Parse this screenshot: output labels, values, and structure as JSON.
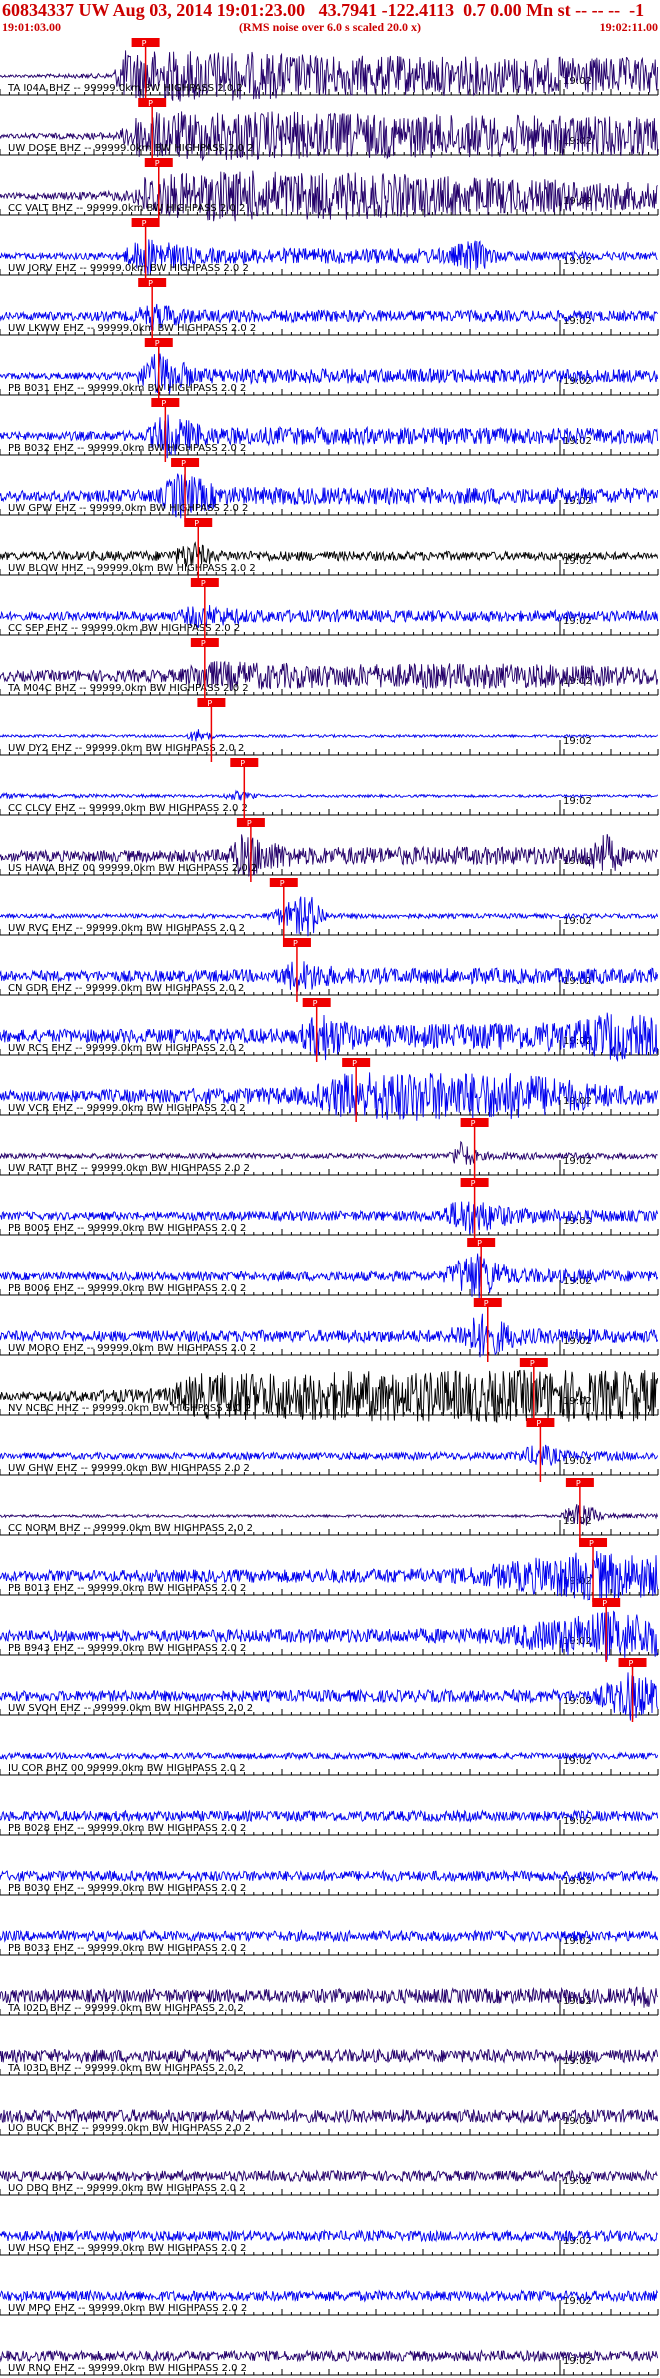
{
  "header": {
    "title": "60834337 UW Aug 03, 2014 19:01:23.00   43.7941 -122.4113  0.7 0.00 Mn st -- -- --  -1",
    "start_time": "19:01:03.00",
    "scale_note": "(RMS noise over 6.0 s scaled 20.0 x)",
    "end_time": "19:02:11.00"
  },
  "colors": {
    "text": "#000000",
    "header_red": "#cc0000",
    "pick": "#ee0000",
    "grid": "#000000"
  },
  "minute_label": "19:02",
  "pick_label": "P",
  "traces": [
    {
      "label": "TA I04A BHZ -- 99999.0km BW HIGHPASS  2.0  2",
      "color": "#24006a",
      "pick": 0.2,
      "env": [
        [
          0,
          0.05
        ],
        [
          0.17,
          0.1
        ],
        [
          0.19,
          1.0
        ],
        [
          0.32,
          1.0
        ],
        [
          0.5,
          0.8
        ],
        [
          1,
          0.7
        ]
      ]
    },
    {
      "label": "UW DOSE BHZ -- 99999.0km BW HIGHPASS  2.0  2",
      "color": "#24006a",
      "pick": 0.21,
      "env": [
        [
          0,
          0.08
        ],
        [
          0.18,
          0.15
        ],
        [
          0.21,
          0.9
        ],
        [
          0.34,
          1.0
        ],
        [
          0.6,
          0.85
        ],
        [
          1,
          0.75
        ]
      ]
    },
    {
      "label": "CC VALT BHZ -- 99999.0km BW HIGHPASS  2.0  2",
      "color": "#24006a",
      "pick": 0.22,
      "env": [
        [
          0,
          0.1
        ],
        [
          0.2,
          0.2
        ],
        [
          0.22,
          0.8
        ],
        [
          0.34,
          1.0
        ],
        [
          0.55,
          0.9
        ],
        [
          1,
          0.5
        ]
      ]
    },
    {
      "label": "UW JORV EHZ -- 99999.0km BW HIGHPASS  2.0  2",
      "color": "#0000ee",
      "pick": 0.2,
      "env": [
        [
          0,
          0.12
        ],
        [
          0.18,
          0.15
        ],
        [
          0.22,
          0.75
        ],
        [
          0.3,
          0.3
        ],
        [
          0.68,
          0.3
        ],
        [
          0.72,
          0.7
        ],
        [
          0.76,
          0.2
        ],
        [
          1,
          0.15
        ]
      ]
    },
    {
      "label": "UW LKWW EHZ -- 99999.0km BW HIGHPASS  2.0  2",
      "color": "#0000ee",
      "pick": 0.21,
      "env": [
        [
          0,
          0.15
        ],
        [
          0.2,
          0.2
        ],
        [
          0.23,
          0.55
        ],
        [
          0.3,
          0.25
        ],
        [
          1,
          0.2
        ]
      ]
    },
    {
      "label": "PB B031 EHZ -- 99999.0km BW HIGHPASS  2.0  2",
      "color": "#0000ee",
      "pick": 0.22,
      "env": [
        [
          0,
          0.12
        ],
        [
          0.2,
          0.15
        ],
        [
          0.24,
          0.95
        ],
        [
          0.3,
          0.3
        ],
        [
          1,
          0.25
        ]
      ]
    },
    {
      "label": "PB B032 EHZ -- 99999.0km BW HIGHPASS  2.0  2",
      "color": "#0000ee",
      "pick": 0.23,
      "env": [
        [
          0,
          0.15
        ],
        [
          0.22,
          0.2
        ],
        [
          0.25,
          0.9
        ],
        [
          0.32,
          0.35
        ],
        [
          1,
          0.3
        ]
      ]
    },
    {
      "label": "UW GPW EHZ -- 99999.0km BW HIGHPASS  2.0  2",
      "color": "#0000ee",
      "pick": 0.26,
      "env": [
        [
          0,
          0.2
        ],
        [
          0.24,
          0.25
        ],
        [
          0.27,
          1.0
        ],
        [
          0.34,
          0.35
        ],
        [
          1,
          0.3
        ]
      ]
    },
    {
      "label": "UW BLOW HHZ -- 99999.0km BW HIGHPASS  2.0  2",
      "color": "#000000",
      "pick": 0.28,
      "env": [
        [
          0,
          0.15
        ],
        [
          0.26,
          0.2
        ],
        [
          0.29,
          0.6
        ],
        [
          0.33,
          0.2
        ],
        [
          1,
          0.15
        ]
      ]
    },
    {
      "label": "CC SEP EHZ -- 99999.0km BW HIGHPASS  2.0  2",
      "color": "#0000ee",
      "pick": 0.29,
      "env": [
        [
          0,
          0.15
        ],
        [
          0.27,
          0.2
        ],
        [
          0.3,
          0.5
        ],
        [
          0.38,
          0.25
        ],
        [
          1,
          0.2
        ]
      ]
    },
    {
      "label": "TA M04C BHZ -- 99999.0km BW HIGHPASS  2.0  2",
      "color": "#24006a",
      "pick": 0.29,
      "env": [
        [
          0,
          0.2
        ],
        [
          0.27,
          0.25
        ],
        [
          0.31,
          0.6
        ],
        [
          0.5,
          0.45
        ],
        [
          0.75,
          0.5
        ],
        [
          1,
          0.35
        ]
      ]
    },
    {
      "label": "UW DY2 EHZ -- 99999.0km BW HIGHPASS  2.0  2",
      "color": "#0000ee",
      "pick": 0.3,
      "env": [
        [
          0,
          0.05
        ],
        [
          0.28,
          0.05
        ],
        [
          0.3,
          0.3
        ],
        [
          0.33,
          0.05
        ],
        [
          1,
          0.05
        ]
      ]
    },
    {
      "label": "CC CLCV EHZ -- 99999.0km BW HIGHPASS  2.0  2",
      "color": "#0000ee",
      "pick": 0.35,
      "env": [
        [
          0,
          0.12
        ],
        [
          0.06,
          0.08
        ],
        [
          0.33,
          0.05
        ],
        [
          0.36,
          0.2
        ],
        [
          0.4,
          0.05
        ],
        [
          1,
          0.05
        ]
      ]
    },
    {
      "label": "US HAWA BHZ 00 99999.0km BW HIGHPASS  2.0  2",
      "color": "#24006a",
      "pick": 0.36,
      "env": [
        [
          0,
          0.2
        ],
        [
          0.34,
          0.25
        ],
        [
          0.37,
          0.9
        ],
        [
          0.45,
          0.35
        ],
        [
          0.88,
          0.35
        ],
        [
          0.92,
          0.9
        ],
        [
          0.95,
          0.3
        ],
        [
          1,
          0.25
        ]
      ]
    },
    {
      "label": "UW RVC EHZ -- 99999.0km BW HIGHPASS  2.0  2",
      "color": "#0000ee",
      "pick": 0.41,
      "env": [
        [
          0,
          0.08
        ],
        [
          0.4,
          0.08
        ],
        [
          0.47,
          0.9
        ],
        [
          0.5,
          0.1
        ],
        [
          1,
          0.08
        ]
      ]
    },
    {
      "label": "CN GDR EHZ -- 99999.0km BW HIGHPASS  2.0  2",
      "color": "#0000ee",
      "pick": 0.43,
      "env": [
        [
          0,
          0.2
        ],
        [
          0.42,
          0.25
        ],
        [
          0.45,
          0.7
        ],
        [
          0.52,
          0.3
        ],
        [
          1,
          0.3
        ]
      ]
    },
    {
      "label": "UW RCS EHZ -- 99999.0km BW HIGHPASS  2.0  2",
      "color": "#0000ee",
      "pick": 0.46,
      "env": [
        [
          0,
          0.25
        ],
        [
          0.45,
          0.3
        ],
        [
          0.49,
          1.0
        ],
        [
          0.55,
          0.4
        ],
        [
          0.88,
          0.6
        ],
        [
          0.93,
          1.0
        ],
        [
          1,
          0.7
        ]
      ]
    },
    {
      "label": "UW VCR EHZ -- 99999.0km BW HIGHPASS  2.0  2",
      "color": "#0000ee",
      "pick": 0.52,
      "env": [
        [
          0,
          0.2
        ],
        [
          0.47,
          0.35
        ],
        [
          0.52,
          0.9
        ],
        [
          0.62,
          1.0
        ],
        [
          0.8,
          0.9
        ],
        [
          0.9,
          0.5
        ],
        [
          1,
          0.3
        ]
      ]
    },
    {
      "label": "UW RATT BHZ -- 99999.0km BW HIGHPASS  2.0  2",
      "color": "#24006a",
      "pick": 0.7,
      "env": [
        [
          0,
          0.1
        ],
        [
          0.68,
          0.1
        ],
        [
          0.7,
          0.6
        ],
        [
          0.73,
          0.15
        ],
        [
          1,
          0.1
        ]
      ]
    },
    {
      "label": "PB B005 EHZ -- 99999.0km BW HIGHPASS  2.0  2",
      "color": "#0000ee",
      "pick": 0.7,
      "env": [
        [
          0,
          0.15
        ],
        [
          0.66,
          0.2
        ],
        [
          0.71,
          0.8
        ],
        [
          0.78,
          0.3
        ],
        [
          1,
          0.2
        ]
      ]
    },
    {
      "label": "PB B006 EHZ -- 99999.0km BW HIGHPASS  2.0  2",
      "color": "#0000ee",
      "pick": 0.71,
      "env": [
        [
          0,
          0.15
        ],
        [
          0.67,
          0.2
        ],
        [
          0.72,
          1.0
        ],
        [
          0.78,
          0.3
        ],
        [
          1,
          0.2
        ]
      ]
    },
    {
      "label": "UW MORO EHZ -- 99999.0km BW HIGHPASS  2.0  2",
      "color": "#0000ee",
      "pick": 0.72,
      "env": [
        [
          0,
          0.2
        ],
        [
          0.68,
          0.25
        ],
        [
          0.73,
          0.9
        ],
        [
          0.8,
          0.3
        ],
        [
          1,
          0.25
        ]
      ]
    },
    {
      "label": "NV NCBC HHZ -- 99999.0km BW HIGHPASS  2.0  2",
      "color": "#000000",
      "pick": 0.79,
      "env": [
        [
          0,
          0.15
        ],
        [
          0.25,
          0.3
        ],
        [
          0.3,
          0.9
        ],
        [
          0.65,
          1.0
        ],
        [
          0.75,
          1.0
        ],
        [
          1,
          1.0
        ]
      ]
    },
    {
      "label": "UW GHW EHZ -- 99999.0km BW HIGHPASS  2.0  2",
      "color": "#0000ee",
      "pick": 0.8,
      "env": [
        [
          0,
          0.12
        ],
        [
          0.78,
          0.15
        ],
        [
          0.82,
          0.5
        ],
        [
          0.86,
          0.2
        ],
        [
          1,
          0.15
        ]
      ]
    },
    {
      "label": "CC NORM BHZ -- 99999.0km BW HIGHPASS  2.0  2",
      "color": "#24006a",
      "pick": 0.86,
      "env": [
        [
          0,
          0.05
        ],
        [
          0.85,
          0.05
        ],
        [
          0.88,
          0.6
        ],
        [
          0.92,
          0.1
        ],
        [
          1,
          0.08
        ]
      ]
    },
    {
      "label": "PB B013 EHZ -- 99999.0km BW HIGHPASS  2.0  2",
      "color": "#0000ee",
      "pick": 0.88,
      "env": [
        [
          0,
          0.2
        ],
        [
          0.7,
          0.3
        ],
        [
          0.9,
          1.0
        ],
        [
          1,
          0.8
        ]
      ]
    },
    {
      "label": "PB B943 EHZ -- 99999.0km BW HIGHPASS  2.0  2",
      "color": "#0000ee",
      "pick": 0.9,
      "env": [
        [
          0,
          0.2
        ],
        [
          0.75,
          0.3
        ],
        [
          0.92,
          1.0
        ],
        [
          1,
          0.8
        ]
      ]
    },
    {
      "label": "UW SVOH EHZ -- 99999.0km BW HIGHPASS  2.0  2",
      "color": "#0000ee",
      "pick": 0.94,
      "env": [
        [
          0,
          0.2
        ],
        [
          0.9,
          0.25
        ],
        [
          0.96,
          1.0
        ],
        [
          1,
          0.6
        ]
      ]
    },
    {
      "label": "IU COR BHZ 00 99999.0km BW HIGHPASS  2.0  2",
      "color": "#0000ee",
      "pick": null,
      "env": [
        [
          0,
          0.12
        ],
        [
          1,
          0.12
        ]
      ]
    },
    {
      "label": "PB B028 EHZ -- 99999.0km BW HIGHPASS  2.0  2",
      "color": "#0000ee",
      "pick": null,
      "env": [
        [
          0,
          0.2
        ],
        [
          1,
          0.2
        ]
      ]
    },
    {
      "label": "PB B030 EHZ -- 99999.0km BW HIGHPASS  2.0  2",
      "color": "#0000ee",
      "pick": null,
      "env": [
        [
          0,
          0.2
        ],
        [
          1,
          0.2
        ]
      ]
    },
    {
      "label": "PB B033 EHZ -- 99999.0km BW HIGHPASS  2.0  2",
      "color": "#0000ee",
      "pick": null,
      "env": [
        [
          0,
          0.2
        ],
        [
          1,
          0.2
        ]
      ]
    },
    {
      "label": "TA I02D BHZ -- 99999.0km BW HIGHPASS  2.0  2",
      "color": "#24006a",
      "pick": null,
      "env": [
        [
          0,
          0.25
        ],
        [
          0.95,
          0.3
        ],
        [
          0.98,
          0.5
        ],
        [
          1,
          0.3
        ]
      ]
    },
    {
      "label": "TA I03D BHZ -- 99999.0km BW HIGHPASS  2.0  2",
      "color": "#24006a",
      "pick": null,
      "env": [
        [
          0,
          0.25
        ],
        [
          1,
          0.25
        ]
      ]
    },
    {
      "label": "UO BUCK BHZ -- 99999.0km BW HIGHPASS  2.0  2",
      "color": "#24006a",
      "pick": null,
      "env": [
        [
          0,
          0.25
        ],
        [
          1,
          0.25
        ]
      ]
    },
    {
      "label": "UO DBO BHZ -- 99999.0km BW HIGHPASS  2.0  2",
      "color": "#24006a",
      "pick": null,
      "env": [
        [
          0,
          0.2
        ],
        [
          1,
          0.2
        ]
      ]
    },
    {
      "label": "UW HSO EHZ -- 99999.0km BW HIGHPASS  2.0  2",
      "color": "#0000ee",
      "pick": null,
      "env": [
        [
          0,
          0.2
        ],
        [
          1,
          0.2
        ]
      ]
    },
    {
      "label": "UW MPO EHZ -- 99999.0km BW HIGHPASS  2.0  2",
      "color": "#0000ee",
      "pick": null,
      "env": [
        [
          0,
          0.2
        ],
        [
          1,
          0.2
        ]
      ]
    },
    {
      "label": "UW RNO EHZ -- 99999.0km BW HIGHPASS  2.0  2",
      "color": "#24006a",
      "pick": null,
      "env": [
        [
          0,
          0.2
        ],
        [
          1,
          0.2
        ]
      ]
    }
  ]
}
